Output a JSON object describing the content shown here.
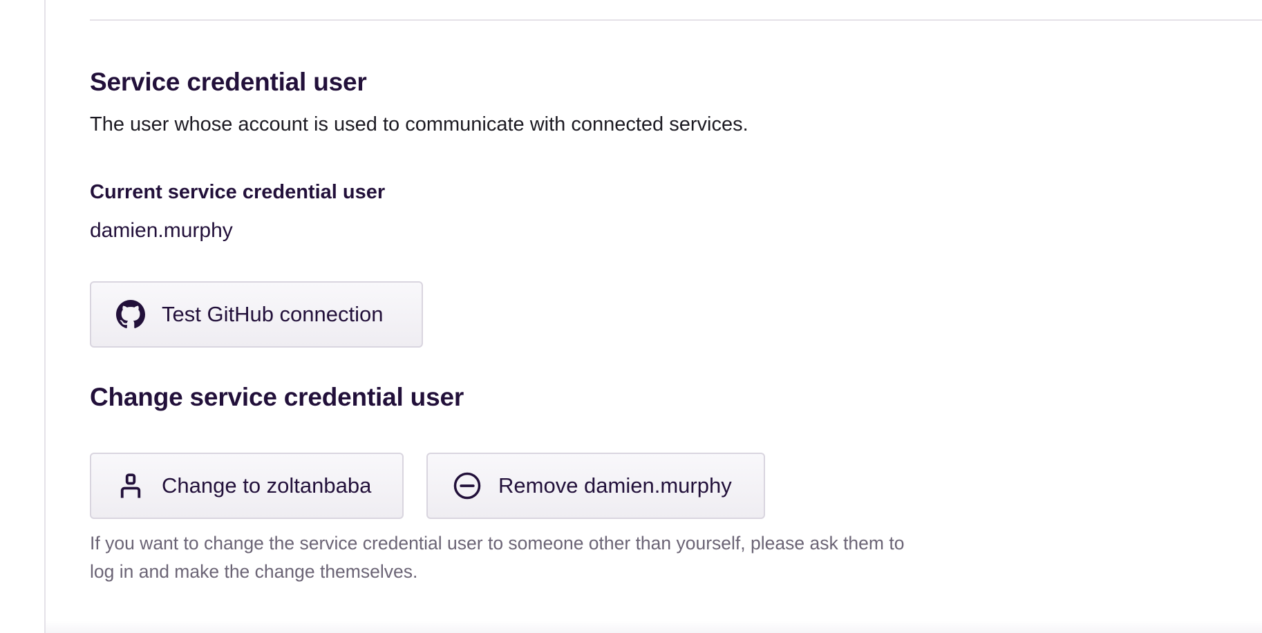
{
  "section": {
    "title": "Service credential user",
    "description": "The user whose account is used to communicate with connected services."
  },
  "current": {
    "label": "Current service credential user",
    "value": "damien.murphy"
  },
  "test_button": {
    "label": "Test GitHub connection",
    "icon": "github-icon"
  },
  "change_section": {
    "title": "Change service credential user",
    "change_button": {
      "label": "Change to zoltanbaba",
      "icon": "user-icon"
    },
    "remove_button": {
      "label": "Remove damien.murphy",
      "icon": "minus-circle-icon"
    },
    "help_text": "If you want to change the service credential user to someone other than yourself, please ask them to log in and make the change themselves."
  },
  "colors": {
    "heading": "#22103a",
    "help_text": "#6b6475",
    "button_border": "#d9d5df",
    "divider": "#e4e1e8"
  }
}
